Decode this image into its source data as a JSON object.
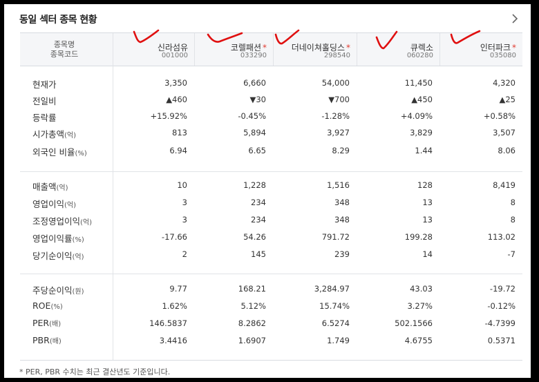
{
  "title": "동일 섹터 종목 현황",
  "header_label": [
    "종목명",
    "종목코드"
  ],
  "stocks": [
    {
      "name": "신라섬유",
      "code": "001000",
      "star": false
    },
    {
      "name": "코렐패션",
      "code": "033290",
      "star": true
    },
    {
      "name": "더네이쳐홀딩스",
      "code": "298540",
      "star": true
    },
    {
      "name": "큐렉소",
      "code": "060280",
      "star": false
    },
    {
      "name": "인터파크",
      "code": "035080",
      "star": true
    }
  ],
  "star_symbol": "*",
  "rows": [
    {
      "label": "현재가",
      "unit": "",
      "values": [
        "3,350",
        "6,660",
        "54,000",
        "11,450",
        "4,320"
      ]
    },
    {
      "label": "전일비",
      "unit": "",
      "values": [
        "▲460",
        "▼30",
        "▼700",
        "▲450",
        "▲25"
      ],
      "dirs": [
        "up",
        "dn",
        "dn",
        "up",
        "up"
      ]
    },
    {
      "label": "등락률",
      "unit": "",
      "values": [
        "+15.92%",
        "-0.45%",
        "-1.28%",
        "+4.09%",
        "+0.58%"
      ],
      "dirs": [
        "up",
        "dn",
        "dn",
        "up",
        "up"
      ]
    },
    {
      "label": "시가총액",
      "unit": "(억)",
      "values": [
        "813",
        "5,894",
        "3,927",
        "3,829",
        "3,507"
      ]
    },
    {
      "label": "외국인 비율",
      "unit": "(%)",
      "values": [
        "6.94",
        "6.65",
        "8.29",
        "1.44",
        "8.06"
      ]
    },
    {
      "label": "매출액",
      "unit": "(억)",
      "values": [
        "10",
        "1,228",
        "1,516",
        "128",
        "8,419"
      ]
    },
    {
      "label": "영업이익",
      "unit": "(억)",
      "values": [
        "3",
        "234",
        "348",
        "13",
        "8"
      ]
    },
    {
      "label": "조정영업이익",
      "unit": "(억)",
      "values": [
        "3",
        "234",
        "348",
        "13",
        "8"
      ]
    },
    {
      "label": "영업이익률",
      "unit": "(%)",
      "values": [
        "-17.66",
        "54.26",
        "791.72",
        "199.28",
        "113.02"
      ]
    },
    {
      "label": "당기순이익",
      "unit": "(억)",
      "values": [
        "2",
        "145",
        "239",
        "14",
        "-7"
      ]
    },
    {
      "label": "주당순이익",
      "unit": "(원)",
      "values": [
        "9.77",
        "168.21",
        "3,284.97",
        "43.03",
        "-19.72"
      ]
    },
    {
      "label": "ROE",
      "unit": "(%)",
      "values": [
        "1.62%",
        "5.12%",
        "15.74%",
        "3.27%",
        "-0.12%"
      ]
    },
    {
      "label": "PER",
      "unit": "(배)",
      "values": [
        "146.5837",
        "8.2862",
        "6.5274",
        "502.1566",
        "-4.7399"
      ]
    },
    {
      "label": "PBR",
      "unit": "(배)",
      "values": [
        "3.4416",
        "1.6907",
        "1.749",
        "4.6755",
        "0.5371"
      ]
    }
  ],
  "footnote": "* PER, PBR 수치는 최근 결산년도 기준입니다.",
  "icons": {
    "more": "chevron-right-icon"
  },
  "colors": {
    "up": "#e03c31",
    "down": "#1f63d8",
    "annotation": "#e01010"
  }
}
